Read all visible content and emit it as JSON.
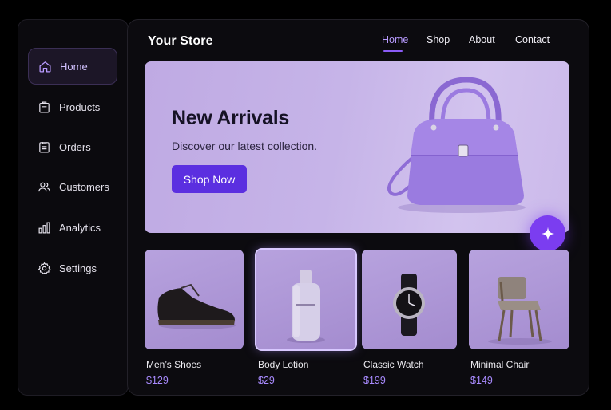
{
  "sidebar": {
    "items": [
      {
        "label": "Home",
        "icon": "home-icon",
        "active": true
      },
      {
        "label": "Products",
        "icon": "clipboard-icon",
        "active": false
      },
      {
        "label": "Orders",
        "icon": "list-icon",
        "active": false
      },
      {
        "label": "Customers",
        "icon": "users-icon",
        "active": false
      },
      {
        "label": "Analytics",
        "icon": "bar-chart-icon",
        "active": false
      },
      {
        "label": "Settings",
        "icon": "gear-icon",
        "active": false
      }
    ]
  },
  "header": {
    "brand": "Your Store",
    "nav": [
      "Home",
      "Shop",
      "About",
      "Contact"
    ],
    "active_nav": "Home"
  },
  "hero": {
    "title": "New Arrivals",
    "subtitle": "Discover our latest collection.",
    "cta": "Shop Now",
    "image_icon": "handbag-image"
  },
  "fab": {
    "icon": "sparkle-icon"
  },
  "products": [
    {
      "name": "Men’s Shoes",
      "price": "$129",
      "icon": "shoe-image"
    },
    {
      "name": "Body Lotion",
      "price": "$29",
      "icon": "lotion-bottle-image",
      "selected": true
    },
    {
      "name": "Classic Watch",
      "price": "$199",
      "icon": "watch-image"
    },
    {
      "name": "Minimal Chair",
      "price": "$149",
      "icon": "chair-image"
    }
  ],
  "colors": {
    "accent": "#7b3df0",
    "button": "#5b2fe0",
    "price": "#a98bff",
    "hero_bg": "#c6b4e8"
  }
}
